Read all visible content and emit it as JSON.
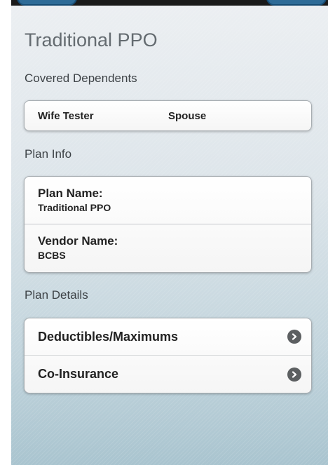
{
  "page": {
    "title": "Traditional PPO"
  },
  "dependents": {
    "label": "Covered Dependents",
    "items": [
      {
        "name": "Wife Tester",
        "relation": "Spouse"
      }
    ]
  },
  "plan_info": {
    "label": "Plan Info",
    "fields": [
      {
        "label": "Plan Name:",
        "value": "Traditional PPO"
      },
      {
        "label": "Vendor Name:",
        "value": "BCBS"
      }
    ]
  },
  "plan_details": {
    "label": "Plan Details",
    "items": [
      {
        "label": "Deductibles/Maximums",
        "icon": "chevron-right-icon"
      },
      {
        "label": "Co-Insurance",
        "icon": "chevron-right-icon"
      }
    ]
  },
  "colors": {
    "header_bar": "#1a1a1a",
    "header_button": "#2e6b97",
    "title": "#646b70"
  }
}
